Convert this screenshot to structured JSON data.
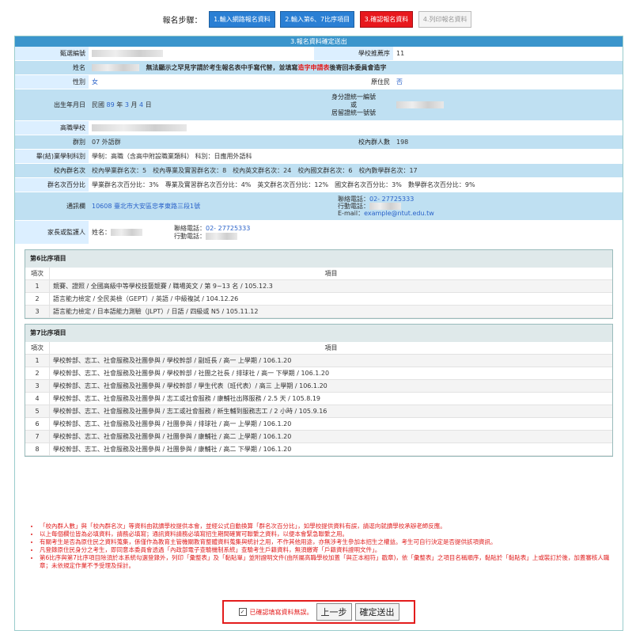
{
  "steps": {
    "label": "報名步驟：",
    "items": [
      {
        "text": "1.輸入網路報名資料"
      },
      {
        "text": "2.輸入第6、7比序項目"
      },
      {
        "text": "3.確認報名資料"
      },
      {
        "text": "4.列印報名資料"
      }
    ]
  },
  "header": {
    "title": "3.報名資料確定送出"
  },
  "info": {
    "exam_no_label": "甄選編號",
    "school_order_label": "學校推薦序",
    "school_order_value": "11",
    "name_label": "姓名",
    "name_note_a": "無法顯示之罕見字請於考生報名表中手寫代替，並填寫",
    "name_note_b": "造字申請表",
    "name_note_c": "後寄回本委員會造字",
    "gender_label": "性別",
    "gender_value": "女",
    "indigenous_label": "原住民",
    "indigenous_value": "否",
    "birth_label": "出生年月日",
    "birth_prefix": "民國",
    "birth_year": "89",
    "birth_year_unit": "年",
    "birth_month": "3",
    "birth_month_unit": "月",
    "birth_day": "4",
    "birth_day_unit": "日",
    "id_label_1": "身分證統一編號",
    "id_label_2": "或",
    "id_label_3": "居留證統一號號",
    "school_label": "高職學校",
    "group_label": "群別",
    "group_value": "07 外語群",
    "school_count_label": "校內群人數",
    "school_count_value": "198",
    "dept_label": "畢(結)業學制科別",
    "dept_value": "學制：高職（含高中附設職業類科） 科別：日應用外語科",
    "rank_label": "校內群名次",
    "rank_value": "校內學業群名次：5　校內專業及實習群名次：8　校內英文群名次：24　校內國文群名次：6　校內數學群名次：17",
    "pct_label": "群名次百分比",
    "pct_value": "學業群名次百分比：3%　專業及實習群名次百分比：4%　英文群名次百分比：12%　國文群名次百分比：3%　數學群名次百分比：9%",
    "address_label": "通訊欄",
    "address_value": "10608 臺北市大安區忠孝東路三段1號",
    "phone_label": "聯絡電話：",
    "phone_value": "02- 27725333",
    "mobile_label": "行動電話：",
    "email_label": "E-mail：",
    "email_value": "example@ntut.edu.tw",
    "guardian_label": "家長或監護人",
    "guardian_name_label": "姓名：",
    "guardian_phone_label": "聯絡電話：",
    "guardian_phone_value": "02- 27725333",
    "guardian_mobile_label": "行動電話："
  },
  "section6": {
    "title": "第6比序項目",
    "col_no": "項次",
    "col_item": "項目",
    "rows": [
      {
        "no": "1",
        "item": "競賽、證照 / 全國高級中等學校技藝競賽 / 職場英文 / 第 9~13 名 / 105.12.3"
      },
      {
        "no": "2",
        "item": "語言能力檢定 / 全民英檢（GEPT）/ 英語 / 中級複試 / 104.12.26"
      },
      {
        "no": "3",
        "item": "語言能力檢定 / 日本語能力測驗（JLPT）/ 日語 / 四級或 N5 / 105.11.12"
      }
    ]
  },
  "section7": {
    "title": "第7比序項目",
    "col_no": "項次",
    "col_item": "項目",
    "rows": [
      {
        "no": "1",
        "item": "學校幹部、志工、社會服務及社團參與 / 學校幹部 / 副班長 / 高一 上學期 / 106.1.20"
      },
      {
        "no": "2",
        "item": "學校幹部、志工、社會服務及社團參與 / 學校幹部 / 社團之社長 / 排球社 / 高一 下學期 / 106.1.20"
      },
      {
        "no": "3",
        "item": "學校幹部、志工、社會服務及社團參與 / 學校幹部 / 學生代表（班代表）/ 高三 上學期 / 106.1.20"
      },
      {
        "no": "4",
        "item": "學校幹部、志工、社會服務及社團參與 / 志工或社會服務 / 康輔社出隊服務 / 2.5 天 / 105.8.19"
      },
      {
        "no": "5",
        "item": "學校幹部、志工、社會服務及社團參與 / 志工或社會服務 / 新生輔到服務志工 / 2 小時 / 105.9.16"
      },
      {
        "no": "6",
        "item": "學校幹部、志工、社會服務及社團參與 / 社團參與 / 排球社 / 高一 上學期 / 106.1.20"
      },
      {
        "no": "7",
        "item": "學校幹部、志工、社會服務及社團參與 / 社團參與 / 康輔社 / 高二 上學期 / 106.1.20"
      },
      {
        "no": "8",
        "item": "學校幹部、志工、社會服務及社團參與 / 社團參與 / 康輔社 / 高二 下學期 / 106.1.20"
      }
    ]
  },
  "notes": [
    "「校內群人數」與「校內群名次」等資料由就讀學校提供本會，並經公式自動換算「群名次百分比」，如學校提供資料有誤，請逕向就讀學校承辦老師反應。",
    "以上每個欄位皆為必填資料，請務必填寫；通訊資料請務必填寫招生期間確實可聯繫之資料，以便本會緊急聯繫之用。",
    "有關考生是否為原住民之資料蒐集，係僅作為教育主管機關教育整體資料蒐集與統計之用，不作其他用途，亦無涉考生參加本招生之權益。考生可自行決定是否提供該項資訊。",
    "凡登錄原住民身分之考生，即同意本委員會透過「內政部電子查驗機制系統」查驗考生戶籍資料，無須繳寄「戶籍資料證明文件」。",
    "第6比序與第7比序項目除須於本系統勾選登錄外，列印「彙整表」及「黏貼單」並附證明文件(由所屬高職學校加蓋「與正本相符」戳章)，依「彙整表」之項目名稱順序，黏貼於「黏貼表」上或裝訂於後，加蓋審核人職章；未依規定作業不予受理及採計。"
  ],
  "submit": {
    "confirm_label": "已確認填寫資料無誤。",
    "back_label": "上一步",
    "submit_label": "確定送出"
  },
  "colors": {
    "accent": "#3b95cc",
    "alert": "#e31c1c",
    "label_bg": "#dcefff"
  }
}
